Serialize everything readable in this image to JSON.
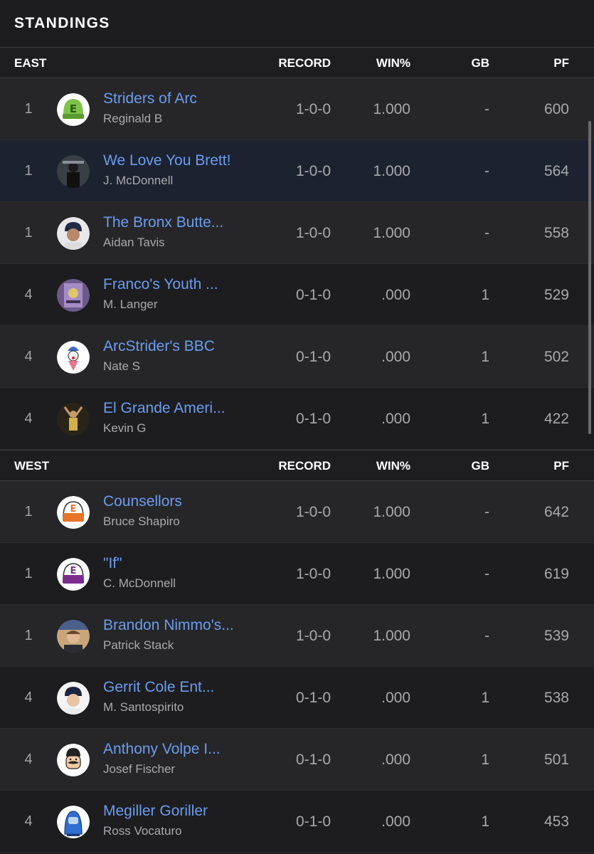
{
  "header": {
    "title": "STANDINGS"
  },
  "columns": {
    "record": "RECORD",
    "win_pct": "WIN%",
    "gb": "GB",
    "pf": "PF"
  },
  "divisions": [
    {
      "name": "EAST",
      "teams": [
        {
          "rank": "1",
          "name": "Striders of Arc",
          "owner": "Reginald B",
          "record": "1-0-0",
          "win_pct": "1.000",
          "gb": "-",
          "pf": "600",
          "avatar": "green-e-cap-icon"
        },
        {
          "rank": "1",
          "name": "We Love You Brett!",
          "owner": "J. McDonnell",
          "record": "1-0-0",
          "win_pct": "1.000",
          "gb": "-",
          "pf": "564",
          "avatar": "photo-avatar"
        },
        {
          "rank": "1",
          "name": "The Bronx Butte...",
          "owner": "Aidan Tavis",
          "record": "1-0-0",
          "win_pct": "1.000",
          "gb": "-",
          "pf": "558",
          "avatar": "photo-avatar"
        },
        {
          "rank": "4",
          "name": "Franco's Youth ...",
          "owner": "M. Langer",
          "record": "0-1-0",
          "win_pct": ".000",
          "gb": "1",
          "pf": "529",
          "avatar": "card-avatar"
        },
        {
          "rank": "4",
          "name": "ArcStrider's BBC",
          "owner": "Nate S",
          "record": "0-1-0",
          "win_pct": ".000",
          "gb": "1",
          "pf": "502",
          "avatar": "clown-avatar"
        },
        {
          "rank": "4",
          "name": "El Grande Ameri...",
          "owner": "Kevin G",
          "record": "0-1-0",
          "win_pct": ".000",
          "gb": "1",
          "pf": "422",
          "avatar": "photo-avatar"
        }
      ]
    },
    {
      "name": "WEST",
      "teams": [
        {
          "rank": "1",
          "name": "Counsellors",
          "owner": "Bruce Shapiro",
          "record": "1-0-0",
          "win_pct": "1.000",
          "gb": "-",
          "pf": "642",
          "avatar": "orange-e-cap-icon"
        },
        {
          "rank": "1",
          "name": "\"If\"",
          "owner": "C. McDonnell",
          "record": "1-0-0",
          "win_pct": "1.000",
          "gb": "-",
          "pf": "619",
          "avatar": "purple-e-cap-icon"
        },
        {
          "rank": "1",
          "name": "Brandon Nimmo's...",
          "owner": "Patrick Stack",
          "record": "1-0-0",
          "win_pct": "1.000",
          "gb": "-",
          "pf": "539",
          "avatar": "photo-avatar"
        },
        {
          "rank": "4",
          "name": "Gerrit Cole Ent...",
          "owner": "M. Santospirito",
          "record": "0-1-0",
          "win_pct": ".000",
          "gb": "1",
          "pf": "538",
          "avatar": "photo-avatar"
        },
        {
          "rank": "4",
          "name": "Anthony Volpe I...",
          "owner": "Josef Fischer",
          "record": "0-1-0",
          "win_pct": ".000",
          "gb": "1",
          "pf": "501",
          "avatar": "mustache-avatar"
        },
        {
          "rank": "4",
          "name": "Megiller Goriller",
          "owner": "Ross Vocaturo",
          "record": "0-1-0",
          "win_pct": ".000",
          "gb": "1",
          "pf": "453",
          "avatar": "gorilla-avatar"
        }
      ]
    }
  ]
}
